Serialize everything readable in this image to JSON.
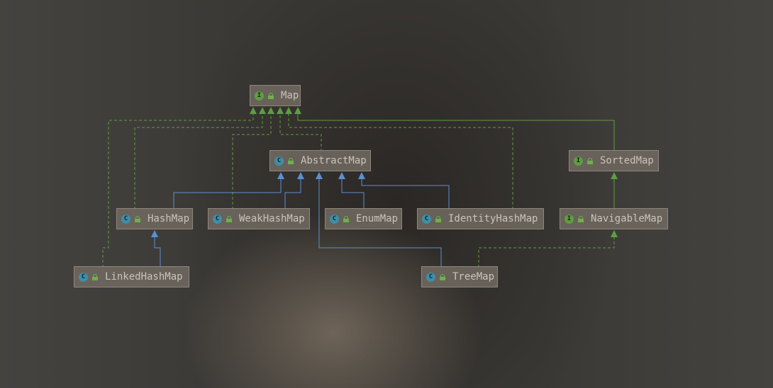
{
  "diagram": {
    "nodes": [
      {
        "id": "map",
        "label": "Map",
        "kind": "interface",
        "badge": "I"
      },
      {
        "id": "abstractmap",
        "label": "AbstractMap",
        "kind": "class",
        "badge": "C"
      },
      {
        "id": "sortedmap",
        "label": "SortedMap",
        "kind": "interface",
        "badge": "I"
      },
      {
        "id": "hashmap",
        "label": "HashMap",
        "kind": "class",
        "badge": "C"
      },
      {
        "id": "weakhashmap",
        "label": "WeakHashMap",
        "kind": "class",
        "badge": "C"
      },
      {
        "id": "enummap",
        "label": "EnumMap",
        "kind": "class",
        "badge": "C"
      },
      {
        "id": "identityhashmap",
        "label": "IdentityHashMap",
        "kind": "class",
        "badge": "C"
      },
      {
        "id": "navigablemap",
        "label": "NavigableMap",
        "kind": "interface",
        "badge": "I"
      },
      {
        "id": "linkedhashmap",
        "label": "LinkedHashMap",
        "kind": "class",
        "badge": "C"
      },
      {
        "id": "treemap",
        "label": "TreeMap",
        "kind": "class",
        "badge": "C"
      }
    ],
    "edges": [
      {
        "from": "abstractmap",
        "to": "map",
        "type": "implements"
      },
      {
        "from": "sortedmap",
        "to": "map",
        "type": "extends"
      },
      {
        "from": "hashmap",
        "to": "map",
        "type": "implements"
      },
      {
        "from": "weakhashmap",
        "to": "map",
        "type": "implements"
      },
      {
        "from": "identityhashmap",
        "to": "map",
        "type": "implements"
      },
      {
        "from": "linkedhashmap",
        "to": "map",
        "type": "implements"
      },
      {
        "from": "hashmap",
        "to": "abstractmap",
        "type": "extends"
      },
      {
        "from": "weakhashmap",
        "to": "abstractmap",
        "type": "extends"
      },
      {
        "from": "treemap",
        "to": "abstractmap",
        "type": "extends"
      },
      {
        "from": "enummap",
        "to": "abstractmap",
        "type": "extends"
      },
      {
        "from": "identityhashmap",
        "to": "abstractmap",
        "type": "extends"
      },
      {
        "from": "linkedhashmap",
        "to": "hashmap",
        "type": "extends"
      },
      {
        "from": "navigablemap",
        "to": "sortedmap",
        "type": "extends"
      },
      {
        "from": "treemap",
        "to": "navigablemap",
        "type": "implements"
      }
    ],
    "colors": {
      "class_extends": "#5b8fd4",
      "interface_link": "#5f9d3f",
      "class_badge": "#3d8fa8",
      "interface_badge": "#5f9d3f"
    }
  }
}
